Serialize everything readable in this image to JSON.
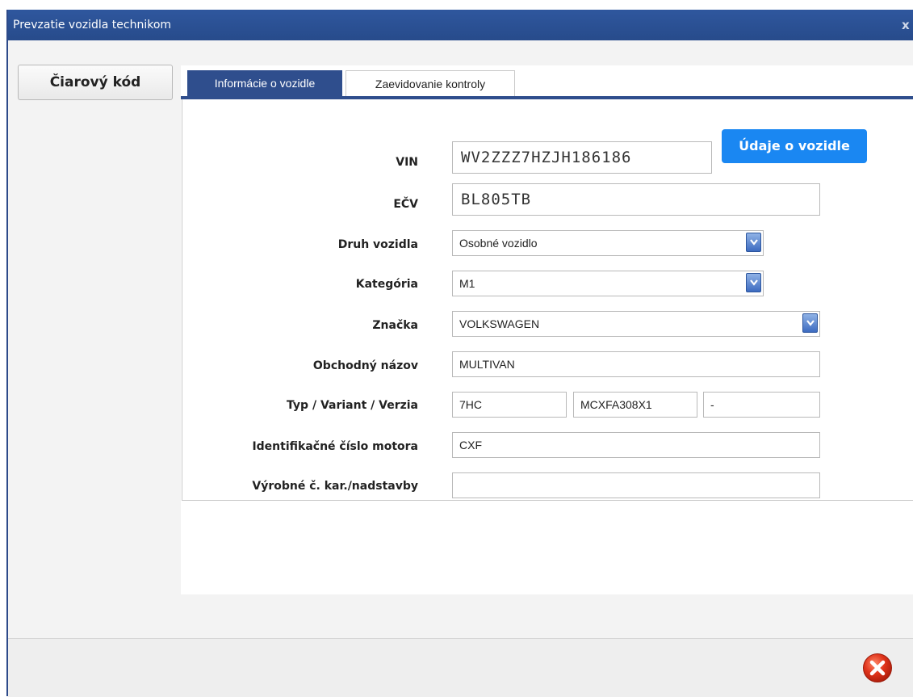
{
  "window": {
    "title": "Prevzatie vozidla technikom",
    "close_glyph": "x"
  },
  "barcode_button": {
    "label": "Čiarový kód"
  },
  "tabs": [
    {
      "label": "Informácie o vozidle",
      "active": true
    },
    {
      "label": "Zaevidovanie kontroly",
      "active": false
    }
  ],
  "form": {
    "vin": {
      "label": "VIN",
      "value": "WV2ZZZ7HZJH186186"
    },
    "vehicle_info_button": "Údaje o vozidle",
    "ecv": {
      "label": "EČV",
      "value": "BL805TB"
    },
    "vehicle_type": {
      "label": "Druh vozidla",
      "value": "Osobné vozidlo"
    },
    "category": {
      "label": "Kategória",
      "value": "M1"
    },
    "brand": {
      "label": "Značka",
      "value": "VOLKSWAGEN"
    },
    "trade_name": {
      "label": "Obchodný názov",
      "value": "MULTIVAN"
    },
    "type_variant_version": {
      "label": "Typ / Variant / Verzia",
      "type": "7HC",
      "variant": "MCXFA308X1",
      "version": "-"
    },
    "engine_id": {
      "label": "Identifikačné číslo motora",
      "value": "CXF"
    },
    "body_number": {
      "label": "Výrobné č. kar./nadstavby",
      "value": ""
    }
  },
  "icons": {
    "dropdown": "chevron-down-icon",
    "close": "close-circle-icon"
  },
  "colors": {
    "titlebar": "#2f579e",
    "accent_button": "#1a87f2",
    "active_tab": "#2f4e8d",
    "close_button": "#e0341b"
  }
}
